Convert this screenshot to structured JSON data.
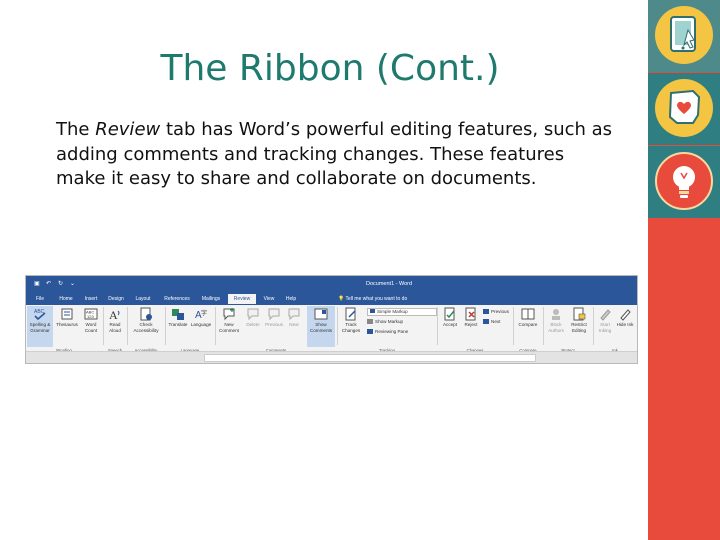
{
  "slide": {
    "title": "The Ribbon (Cont.)",
    "body_before": "The ",
    "body_emphasis": "Review",
    "body_after": " tab has Word’s powerful editing features, such as adding comments and tracking changes. These features make it easy to share and collaborate on documents."
  },
  "sidebar_icons": [
    "tablet-touch-icon",
    "ohio-heart-icon",
    "lightbulb-icon"
  ],
  "ribbon": {
    "document_title": "Document1  -  Word",
    "tabs": [
      "File",
      "Home",
      "Insert",
      "Design",
      "Layout",
      "References",
      "Mailings",
      "Review",
      "View",
      "Help"
    ],
    "active_tab": "Review",
    "tell_me": "Tell me what you want to do",
    "buttons": {
      "spelling": "Spelling & Grammar",
      "thesaurus": "Thesaurus",
      "word_count": "Word Count",
      "read_aloud": "Read Aloud",
      "check_accessibility": "Check Accessibility",
      "translate": "Translate",
      "language": "Language",
      "new_comment": "New Comment",
      "delete": "Delete",
      "previous": "Previous",
      "next": "Next",
      "show_comments": "Show Comments",
      "track_changes": "Track Changes",
      "simple_markup": "Simple Markup",
      "show_markup": "Show Markup",
      "reviewing_pane": "Reviewing Pane",
      "accept": "Accept",
      "reject": "Reject",
      "change_previous": "Previous",
      "change_next": "Next",
      "compare": "Compare",
      "block_authors": "Block Authors",
      "restrict_editing": "Restrict Editing",
      "start_inking": "Start Inking",
      "hide_ink": "Hide Ink"
    },
    "groups": {
      "proofing": "Proofing",
      "speech": "Speech",
      "accessibility": "Accessibility",
      "language": "Language",
      "comments": "Comments",
      "tracking": "Tracking",
      "changes": "Changes",
      "compare": "Compare",
      "protect": "Protect",
      "ink": "Ink"
    }
  },
  "colors": {
    "title": "#1f7a6e",
    "sidebar_red": "#e84a3c",
    "sidebar_teal": "#2f7f82",
    "badge_yellow": "#f3c542",
    "ribbon_blue": "#2b579a"
  }
}
